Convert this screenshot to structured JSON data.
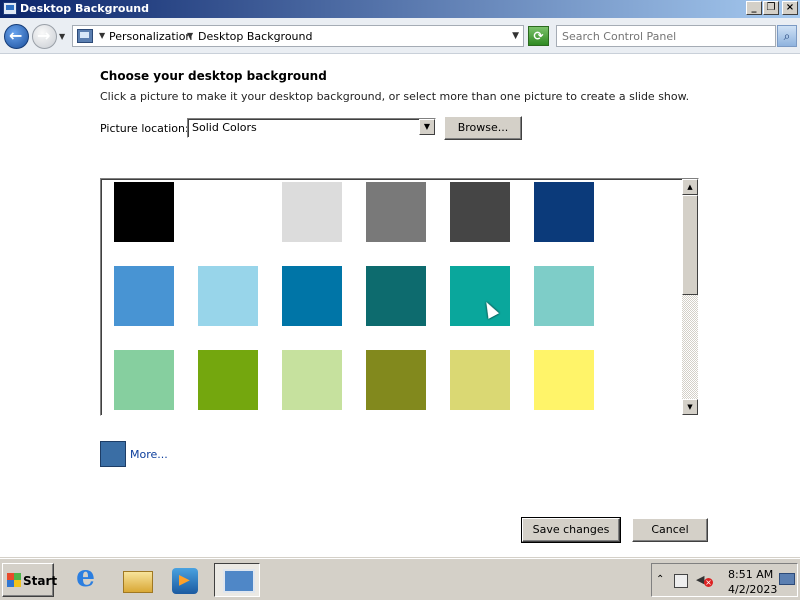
{
  "window": {
    "title": "Desktop Background"
  },
  "titlebar_buttons": {
    "minimize": "_",
    "restore": "❐",
    "close": "×"
  },
  "address": {
    "breadcrumbs": [
      "Personalization",
      "Desktop Background"
    ],
    "search_placeholder": "Search Control Panel"
  },
  "content": {
    "heading": "Choose your desktop background",
    "subtext": "Click a picture to make it your desktop background, or select more than one picture to create a slide show.",
    "location_label": "Picture location:",
    "location_value": "Solid Colors",
    "browse_label": "Browse...",
    "more_label": "More...",
    "save_label": "Save changes",
    "cancel_label": "Cancel"
  },
  "swatches": [
    [
      "#000000",
      "#ffffff",
      "#dcdcdc",
      "#797979",
      "#454545",
      "#0b3a7a"
    ],
    [
      "#4894d3",
      "#98d5ea",
      "#0075a7",
      "#0d6b6e",
      "#0aa79c",
      "#7ecdc8"
    ],
    [
      "#86cf9f",
      "#74a70e",
      "#c6e19e",
      "#82891d",
      "#dad873",
      "#fff469"
    ]
  ],
  "taskbar": {
    "start_label": "Start",
    "time": "8:51 AM",
    "date": "4/2/2023"
  }
}
